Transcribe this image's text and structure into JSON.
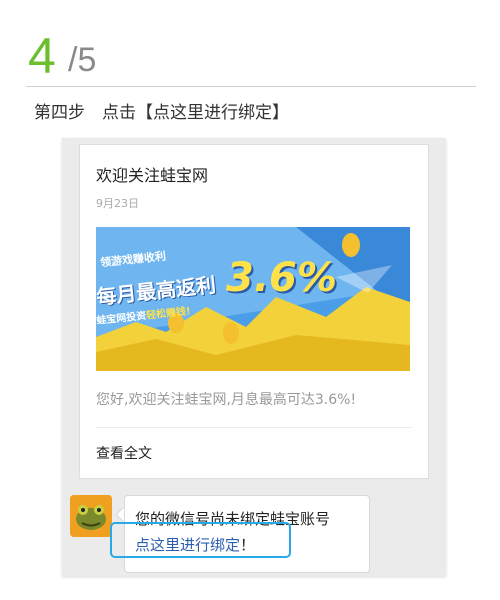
{
  "step": {
    "current": "4",
    "total": "/5"
  },
  "instruction": "第四步　点击【点这里进行绑定】",
  "card": {
    "title": "欢迎关注蛙宝网",
    "date": "9月23日",
    "banner": {
      "line1": "领游戏赚收利",
      "line2": "每月最高返利",
      "line3_prefix": "蛙宝网投资",
      "line3_highlight": "轻松赚钱!",
      "big_rate": "3.6%"
    },
    "description": "您好,欢迎关注蛙宝网,月息最高可达3.6%!",
    "read_more": "查看全文"
  },
  "message": {
    "line1": "您的微信号尚未绑定蛙宝账号",
    "link": "点这里进行绑定",
    "suffix": "！"
  },
  "colors": {
    "accent_green": "#6bbf2e",
    "link_blue": "#2a5fb0",
    "highlight_border": "#29a9e6",
    "banner_blue": "#4a9ee8",
    "banner_yellow": "#f2d13a"
  },
  "icons": {
    "avatar": "frog-avatar-icon",
    "coin": "coin-icon"
  }
}
